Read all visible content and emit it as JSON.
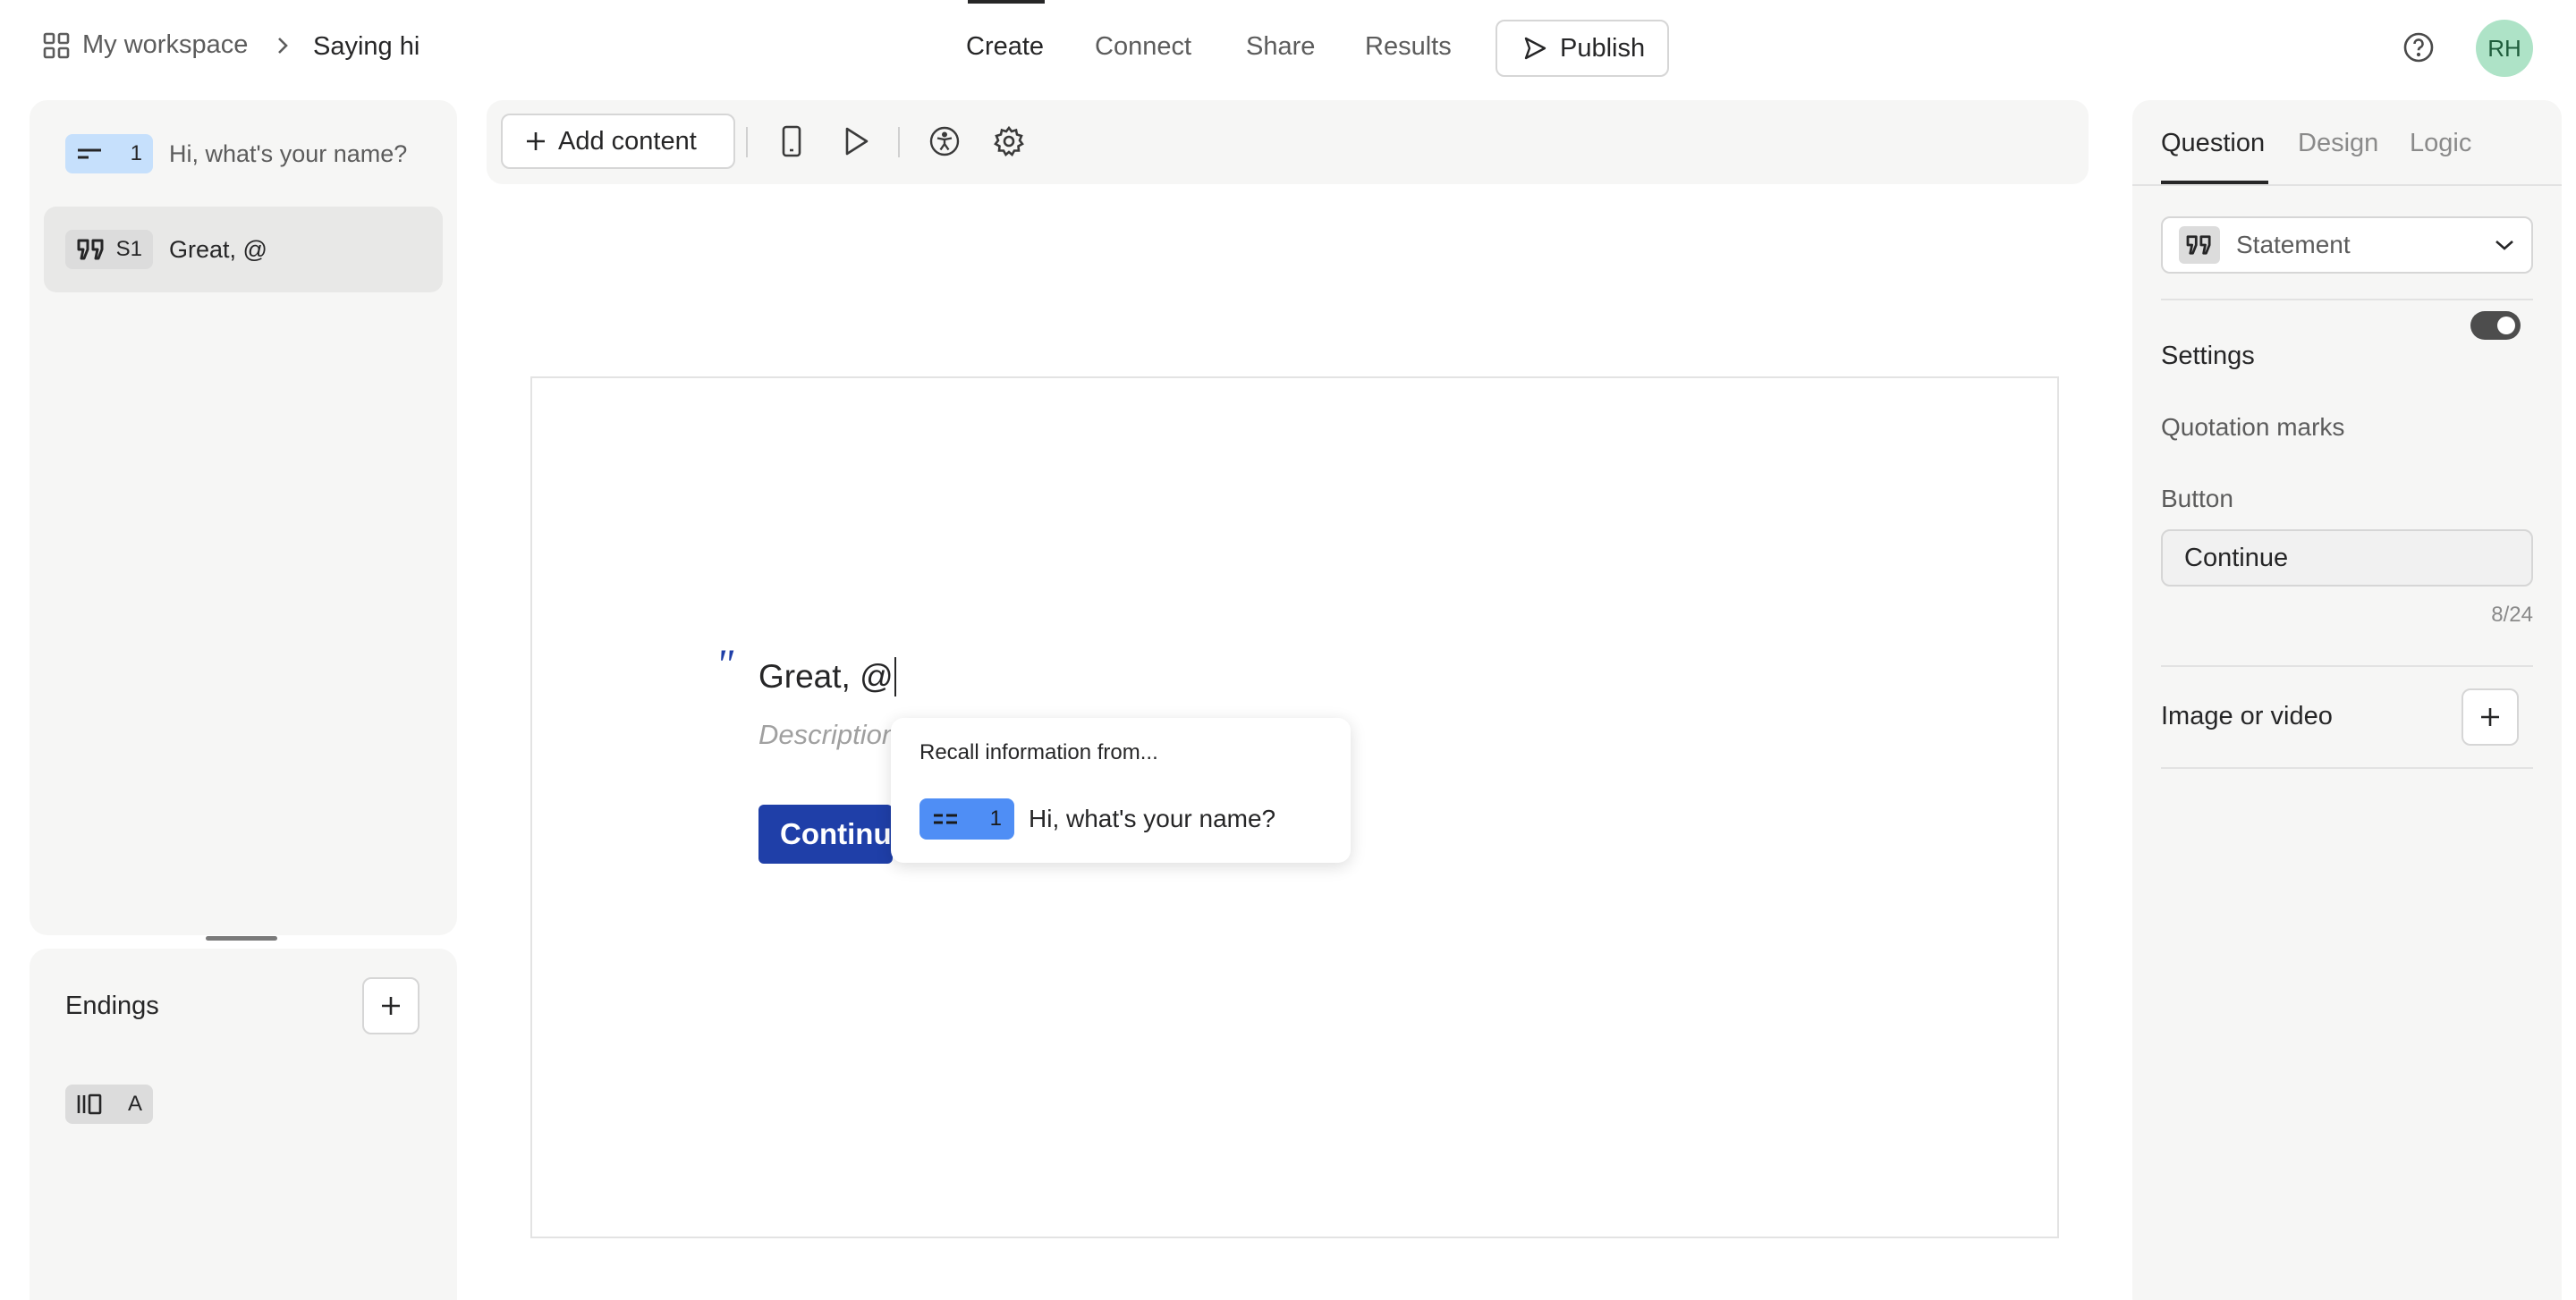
{
  "nav": {
    "workspace": "My workspace",
    "separator": "›",
    "form_name": "Saying hi",
    "tabs": [
      {
        "label": "Create",
        "active": true
      },
      {
        "label": "Connect",
        "active": false
      },
      {
        "label": "Share",
        "active": false
      },
      {
        "label": "Results",
        "active": false
      }
    ],
    "publish_label": "Publish",
    "avatar_initials": "RH"
  },
  "questions": [
    {
      "badge": "1",
      "label": "Hi, what's your name?",
      "type_icon": "short-text-icon",
      "selected": false
    },
    {
      "badge": "S1",
      "label": "Great, @",
      "type_icon": "quote-icon",
      "selected": true
    }
  ],
  "endings": {
    "title": "Endings",
    "items": [
      {
        "badge": "A",
        "type_icon": "ending-icon"
      }
    ]
  },
  "toolbar": {
    "add_content_label": "Add content"
  },
  "canvas": {
    "quote_mark": "\"",
    "title": "Great, @",
    "description_placeholder": "Description",
    "button_label": "Continue"
  },
  "recall_popup": {
    "title": "Recall information from...",
    "items": [
      {
        "badge": "1",
        "label": "Hi, what's your name?"
      }
    ]
  },
  "right_panel": {
    "tabs": [
      {
        "label": "Question",
        "active": true
      },
      {
        "label": "Design",
        "active": false
      },
      {
        "label": "Logic",
        "active": false
      }
    ],
    "type_select": "Statement",
    "settings_title": "Settings",
    "quotation_marks_label": "Quotation marks",
    "quotation_marks_on": true,
    "button_label": "Button",
    "button_value": "Continue",
    "button_counter": "8/24",
    "image_video_label": "Image or video"
  },
  "colors": {
    "accent_blue": "#1f3fa8",
    "badge_blue": "#c6e0fc",
    "popup_badge": "#4f8ef5",
    "avatar_bg": "#aee3c7"
  }
}
